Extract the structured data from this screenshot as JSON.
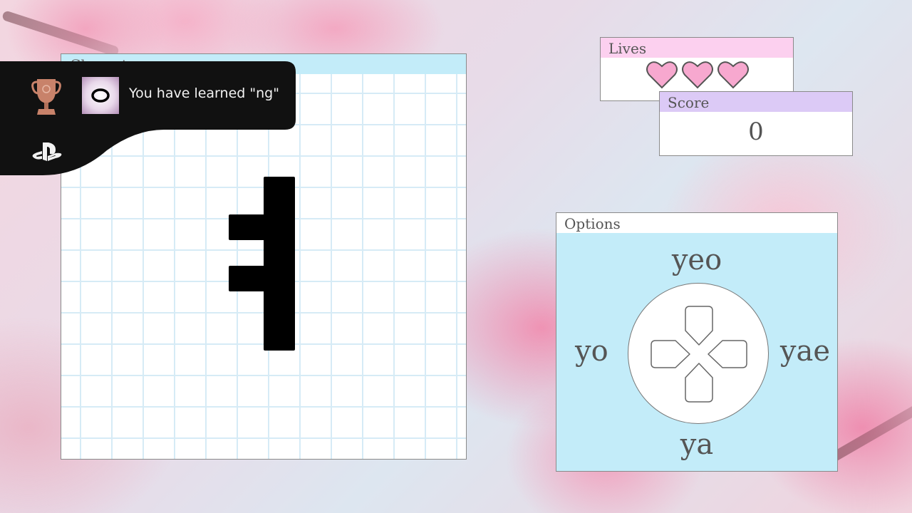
{
  "notification": {
    "message": "You have learned \"ng\"",
    "trophy_icon": "bronze-trophy-icon",
    "platform_icon": "playstation-icon",
    "thumbnail_icon": "circle-symbol-icon"
  },
  "character_panel": {
    "title": "Character"
  },
  "lives": {
    "title": "Lives",
    "count": 3,
    "heart_color": "#f7a8cf"
  },
  "score": {
    "title": "Score",
    "value": "0"
  },
  "options": {
    "title": "Options",
    "up": "yeo",
    "left": "yo",
    "right": "yae",
    "down": "ya"
  },
  "colors": {
    "cyan_panel": "#c3ecf9",
    "lives_header": "#fcd0ef",
    "score_header": "#dccaf6"
  }
}
